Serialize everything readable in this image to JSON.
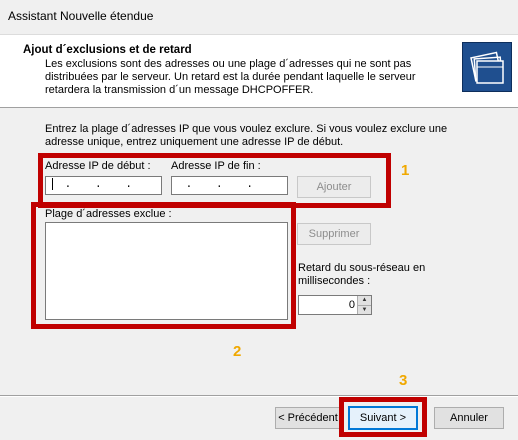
{
  "window": {
    "title": "Assistant Nouvelle étendue"
  },
  "header": {
    "title": "Ajout d´exclusions et de retard",
    "description": "Les exclusions sont des adresses ou une plage d´adresses qui ne sont pas distribuées par le serveur. Un retard est la durée pendant laquelle le serveur retardera la transmission d´un message DHCPOFFER.",
    "icon": "dhcp-scope-folders-icon"
  },
  "instructions": "Entrez la plage d´adresses IP que vous voulez exclure. Si vous voulez exclure une adresse unique, entrez uniquement une adresse IP de début.",
  "start_ip": {
    "label": "Adresse IP de début :",
    "value": " .   .   . "
  },
  "end_ip": {
    "label": "Adresse IP de fin :",
    "value": " .   .   . "
  },
  "buttons": {
    "add": "Ajouter",
    "remove": "Supprimer",
    "back": "< Précédent",
    "next": "Suivant >",
    "cancel": "Annuler"
  },
  "excluded_list": {
    "label": "Plage d´adresses exclue :",
    "items": []
  },
  "delay": {
    "label": "Retard du sous-réseau en millisecondes :",
    "value": "0"
  },
  "callouts": [
    "1",
    "2",
    "3"
  ],
  "colors": {
    "annotation_box": "#c00000",
    "callout_number": "#f0a800",
    "header_icon": "#1f4f8f"
  }
}
